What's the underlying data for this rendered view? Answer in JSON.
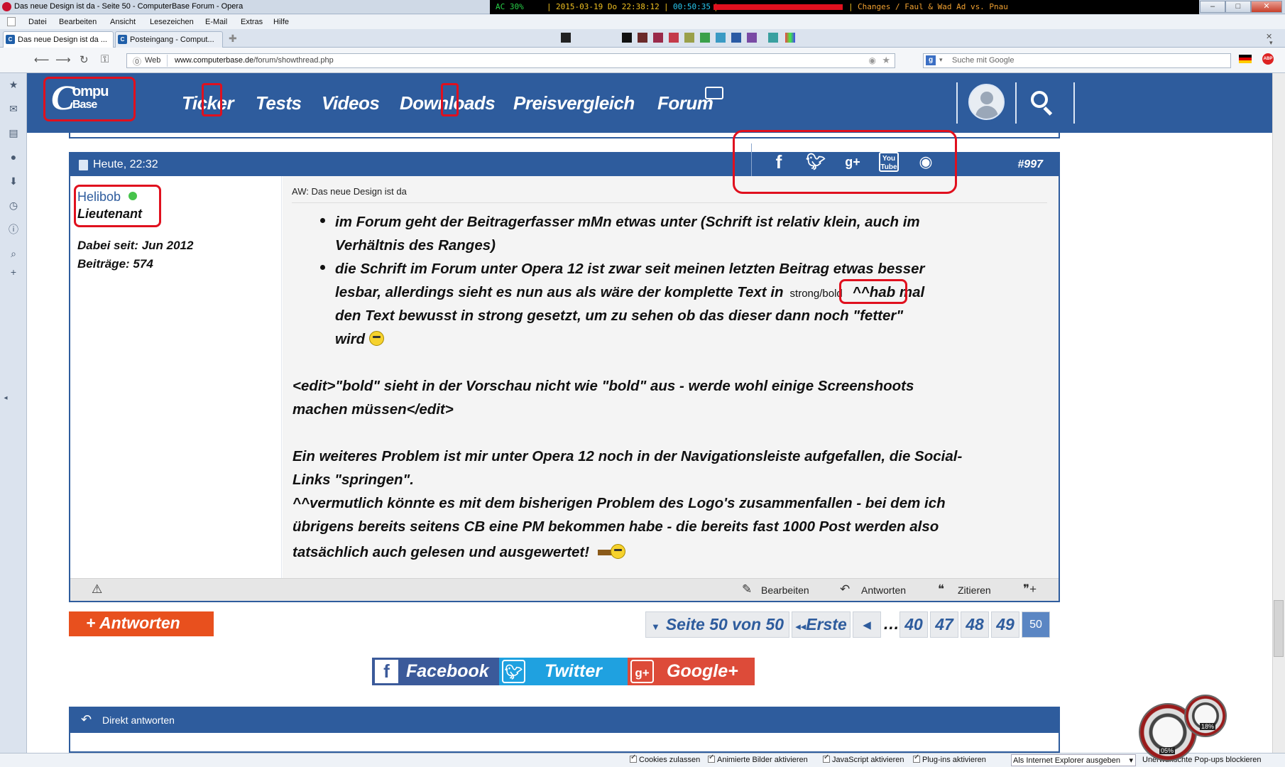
{
  "window": {
    "title": "Das neue Design ist da - Seite 50 - ComputerBase Forum - Opera",
    "status_strip": {
      "ac": "AC  30%",
      "datetime": "2015-03-19 Do 22:38:12",
      "uptime": "00:50:35",
      "now_playing": "Changes / Faul & Wad Ad vs. Pnau"
    },
    "controls": [
      "–",
      "□",
      "✕"
    ]
  },
  "menu": [
    "Datei",
    "Bearbeiten",
    "Ansicht",
    "Lesezeichen",
    "E-Mail",
    "Extras",
    "Hilfe"
  ],
  "tabs": [
    {
      "label": "Das neue Design ist da ...",
      "active": true
    },
    {
      "label": "Posteingang - Comput...",
      "active": false
    }
  ],
  "address": {
    "web_label": "Web",
    "url_host": "www.computerbase.de",
    "url_path": "/forum/showthread.php",
    "search_placeholder": "Suche mit Google"
  },
  "site": {
    "logo_c": "C",
    "logo_line1": "ompu",
    "logo_line2": "Base",
    "nav": [
      "Ticker",
      "Tests",
      "Videos",
      "Downloads",
      "Preisvergleich",
      "Forum"
    ]
  },
  "post": {
    "date": "Heute, 22:32",
    "number": "#997",
    "social_icons": [
      "facebook-icon",
      "twitter-icon",
      "google-plus-icon",
      "youtube-icon",
      "rss-icon"
    ],
    "author": {
      "name": "Helibob",
      "rank": "Lieutenant",
      "joined": "Dabei seit: Jun 2012",
      "posts": "Beiträge: 574"
    },
    "subject": "AW: Das neue Design ist da",
    "bullet1_line1": "im Forum geht der Beitragerfasser mMn etwas unter (Schrift ist relativ klein, auch im",
    "bullet1_line2": "Verhältnis des Ranges)",
    "bullet2_line1": "die Schrift im Forum unter Opera 12 ist zwar seit meinen letzten Beitrag etwas besser",
    "bullet2_line2_a": "lesbar, allerdings sieht es nun aus als wäre der komplette Text in",
    "bullet2_line2_code": "strong/bold",
    "bullet2_line2_b": "^^hab mal",
    "bullet2_line3": "den Text bewusst in strong gesetzt, um zu sehen ob das dieser dann noch \"fetter\"",
    "bullet2_line4": "wird",
    "edit_line1": "<edit>\"bold\" sieht in der Vorschau nicht wie \"bold\" aus - werde wohl einige Screenshoots",
    "edit_line2": "machen müssen</edit>",
    "para_line1": "Ein weiteres Problem ist mir unter Opera 12 noch in der Navigationsleiste aufgefallen, die Social-",
    "para_line2": "Links \"springen\".",
    "para_line3": "^^vermutlich könnte es mit dem bisherigen Problem des Logo's zusammenfallen - bei dem ich",
    "para_line4": "übrigens bereits seitens CB eine PM bekommen habe - die bereits fast 1000 Post werden also",
    "para_line5": "tatsächlich auch gelesen und ausgewertet!",
    "actions": {
      "edit": "Bearbeiten",
      "reply": "Antworten",
      "quote": "Zitieren"
    }
  },
  "reply_button": "+ Antworten",
  "pagination": {
    "label": "Seite 50 von 50",
    "first": "Erste",
    "prev": "◂",
    "ellipsis": "…",
    "pages": [
      "40",
      "47",
      "48",
      "49"
    ],
    "current": "50"
  },
  "share": {
    "facebook": "Facebook",
    "twitter": "Twitter",
    "google": "Google+"
  },
  "quick_reply": "Direkt antworten",
  "statusbar": {
    "cookies": "Cookies zulassen",
    "images": "Animierte Bilder aktivieren",
    "javascript": "JavaScript aktivieren",
    "plugins": "Plug-ins aktivieren",
    "identify_as": "Als Internet Explorer ausgeben",
    "popups": "Unerwünschte Pop-ups blockieren"
  },
  "gauges": {
    "left": "05%",
    "right": "18%"
  },
  "colors": {
    "brand_blue": "#2e5c9d",
    "reply_orange": "#e8501e",
    "facebook": "#3b5a9a",
    "twitter": "#1fa1e0",
    "google": "#dd4b39",
    "annotation_red": "#e0101e"
  }
}
